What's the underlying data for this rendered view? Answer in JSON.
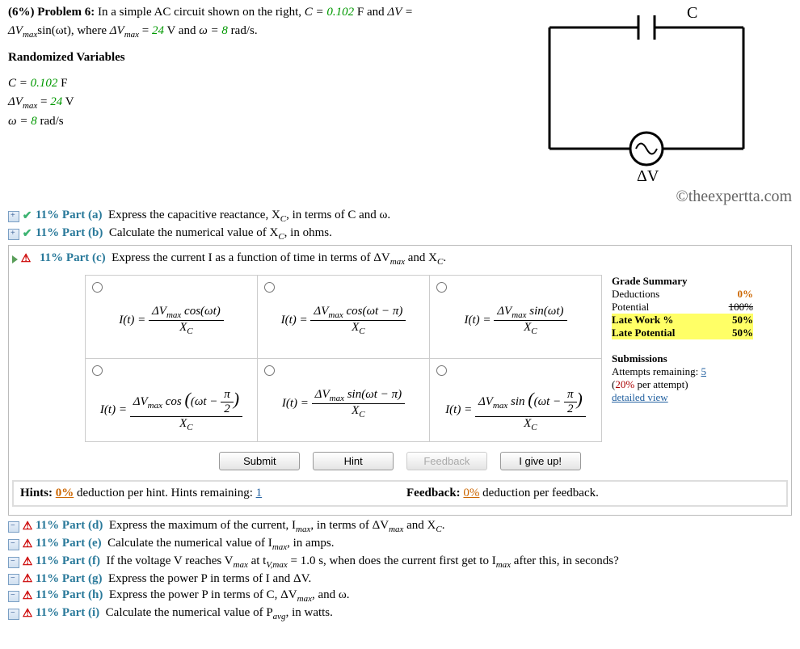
{
  "problem": {
    "weight": "(6%)",
    "number": "Problem 6:",
    "text1": "In a simple AC circuit shown on the right, ",
    "c_label": "C = ",
    "c_value": "0.102",
    "c_unit": " F and ",
    "dv_label": "ΔV = ",
    "dv_eq": "ΔV",
    "dv_sub": "max",
    "dv_eq2": "sin(ωt), where ",
    "dv_eq3": "ΔV",
    "dv_sub2": "max",
    "dv_eq4": " = ",
    "dv_value": "24",
    "dv_unit": " V and ",
    "omega_label": "ω = ",
    "omega_value": "8",
    "omega_unit": " rad/s."
  },
  "randvars": {
    "title": "Randomized Variables",
    "l1": "C = ",
    "v1": "0.102",
    "u1": " F",
    "l2": "ΔV",
    "s2": "max",
    "eq2": " = ",
    "v2": "24",
    "u2": " V",
    "l3": "ω = ",
    "v3": "8",
    "u3": " rad/s"
  },
  "circuit": {
    "c_label": "C",
    "dv_label": "ΔV"
  },
  "copyright": "©theexpertta.com",
  "parts": {
    "a": {
      "pct": "11% Part (a)",
      "text": "Express the capacitive reactance, X",
      "sub": "C",
      "text2": ", in terms of C and ω."
    },
    "b": {
      "pct": "11% Part (b)",
      "text": "Calculate the numerical value of X",
      "sub": "C",
      "text2": ", in ohms."
    },
    "c": {
      "pct": "11% Part (c)",
      "text": "Express the current I as a function of time in terms of ΔV",
      "sub": "max",
      "text2": " and X",
      "sub2": "C",
      "text3": "."
    },
    "d": {
      "pct": "11% Part (d)",
      "text": "Express the maximum of the current, I",
      "sub": "max",
      "text2": ", in terms of ΔV",
      "sub2": "max",
      "text3": " and X",
      "sub3": "C",
      "text4": "."
    },
    "e": {
      "pct": "11% Part (e)",
      "text": "Calculate the numerical value of I",
      "sub": "max",
      "text2": ", in amps."
    },
    "f": {
      "pct": "11% Part (f)",
      "text": "If the voltage V reaches V",
      "sub": "max",
      "text2": " at t",
      "sub2": "V,max",
      "text3": " = 1.0 s, when does the current first get to I",
      "sub3": "max",
      "text4": " after this, in seconds?"
    },
    "g": {
      "pct": "11% Part (g)",
      "text": "Express the power P in terms of I and ΔV."
    },
    "h": {
      "pct": "11% Part (h)",
      "text": "Express the power P in terms of C, ΔV",
      "sub": "max",
      "text2": ", and ω."
    },
    "i": {
      "pct": "11% Part (i)",
      "text": "Calculate the numerical value of P",
      "sub": "avg",
      "text2": ", in watts."
    }
  },
  "choices": {
    "lhs": "I(t) = ",
    "dv": "ΔV",
    "dvsub": "max",
    "xc": "X",
    "xcsub": "C",
    "f1": "cos(ωt)",
    "f2": "cos(ωt − π)",
    "f3": "sin(ωt)",
    "f4a": "cos",
    "f4b": "(ωt − ",
    "f4c": ")",
    "pi2": "π",
    "pi2d": "2",
    "f5": "sin(ωt − π)",
    "f6a": "sin",
    "f6b": "(ωt − ",
    "f6c": ")"
  },
  "buttons": {
    "submit": "Submit",
    "hint": "Hint",
    "feedback": "Feedback",
    "giveup": "I give up!"
  },
  "summary": {
    "title": "Grade Summary",
    "ded": "Deductions",
    "dedv": "0%",
    "pot": "Potential",
    "potv": "100%",
    "late": "Late Work %",
    "latev": "50%",
    "latepot": "Late Potential",
    "latepotv": "50%",
    "subs": "Submissions",
    "att": "Attempts remaining: ",
    "attn": "5",
    "pen": "(",
    "penv": "20%",
    "pen2": " per attempt)",
    "detail": "detailed view"
  },
  "hints": {
    "h1": "Hints: ",
    "h1v": "0%",
    "h1t": " deduction per hint. Hints remaining: ",
    "h1n": "1",
    "f1": "Feedback: ",
    "f1v": "0%",
    "f1t": " deduction per feedback."
  }
}
